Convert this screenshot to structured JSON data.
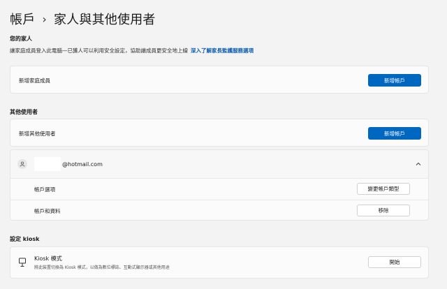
{
  "breadcrumb": {
    "parent": "帳戶",
    "separator": "›",
    "current": "家人與其他使用者"
  },
  "family": {
    "title": "您的家人",
    "description": "讓家庭成員登入此電腦—已獲人可以利用安全設定，協助讓成員更安全地上線",
    "link": "深入了解家長監護服務選項",
    "add_label": "新增家庭成員",
    "add_button": "新增帳戶"
  },
  "other_users": {
    "title": "其他使用者",
    "add_label": "新增其他使用者",
    "add_button": "新增帳戶",
    "account": {
      "email": "@hotmail.com",
      "options_label": "帳戶選項",
      "change_type_button": "變更帳戶類型",
      "data_label": "帳戶和資料",
      "remove_button": "移除"
    }
  },
  "kiosk": {
    "title": "設定 kiosk",
    "item_title": "Kiosk 模式",
    "item_desc": "將此裝置切換為 Kiosk 模式，以做為數位標誌、互動式顯示器或其他用途",
    "start_button": "開始"
  },
  "colors": {
    "accent": "#0067c0",
    "background": "#f3f3f3",
    "card": "#fbfbfb"
  }
}
